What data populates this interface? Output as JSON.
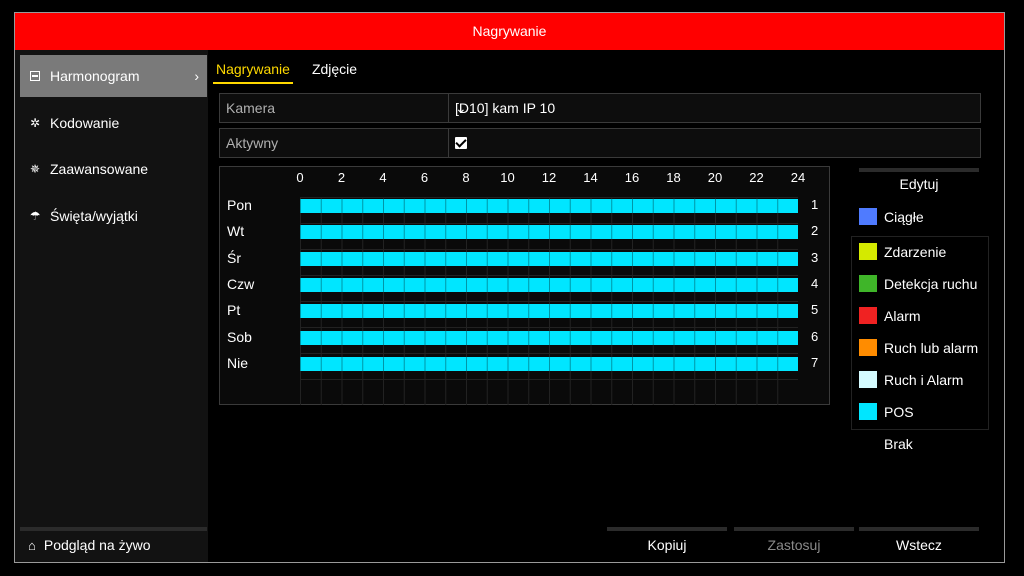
{
  "window": {
    "title": "Nagrywanie"
  },
  "sidebar": {
    "items": [
      {
        "label": "Harmonogram",
        "icon": "schedule-icon",
        "active": true
      },
      {
        "label": "Kodowanie",
        "icon": "gear-icon"
      },
      {
        "label": "Zaawansowane",
        "icon": "advanced-gear-icon"
      },
      {
        "label": "Święta/wyjątki",
        "icon": "umbrella-icon"
      }
    ],
    "live_view": {
      "label": "Podgląd na żywo",
      "icon": "home-icon"
    }
  },
  "tabs": [
    {
      "label": "Nagrywanie",
      "active": true
    },
    {
      "label": "Zdjęcie"
    }
  ],
  "form": {
    "camera_label": "Kamera",
    "camera_value": "[D10] kam IP 10",
    "active_label": "Aktywny",
    "active_checked": true
  },
  "schedule": {
    "hours": [
      "0",
      "2",
      "4",
      "6",
      "8",
      "10",
      "12",
      "14",
      "16",
      "18",
      "20",
      "22",
      "24"
    ],
    "days": [
      {
        "name": "Pon",
        "num": "1",
        "type": "POS"
      },
      {
        "name": "Wt",
        "num": "2",
        "type": "POS"
      },
      {
        "name": "Śr",
        "num": "3",
        "type": "POS"
      },
      {
        "name": "Czw",
        "num": "4",
        "type": "POS"
      },
      {
        "name": "Pt",
        "num": "5",
        "type": "POS"
      },
      {
        "name": "Sob",
        "num": "6",
        "type": "POS"
      },
      {
        "name": "Nie",
        "num": "7",
        "type": "POS"
      }
    ]
  },
  "edit_button": "Edytuj",
  "legend": [
    {
      "label": "Ciągłe",
      "color": "#4f7bff"
    },
    {
      "label": "Zdarzenie",
      "color": "#d4ea00"
    },
    {
      "label": "Detekcja ruchu",
      "color": "#3fb529"
    },
    {
      "label": "Alarm",
      "color": "#f02222"
    },
    {
      "label": "Ruch lub alarm",
      "color": "#ff8c00"
    },
    {
      "label": "Ruch i Alarm",
      "color": "#d4fbff"
    },
    {
      "label": "POS",
      "color": "#00e6ff"
    },
    {
      "label": "Brak",
      "color": "#000000"
    }
  ],
  "buttons": {
    "copy": "Kopiuj",
    "apply": "Zastosuj",
    "back": "Wstecz"
  }
}
